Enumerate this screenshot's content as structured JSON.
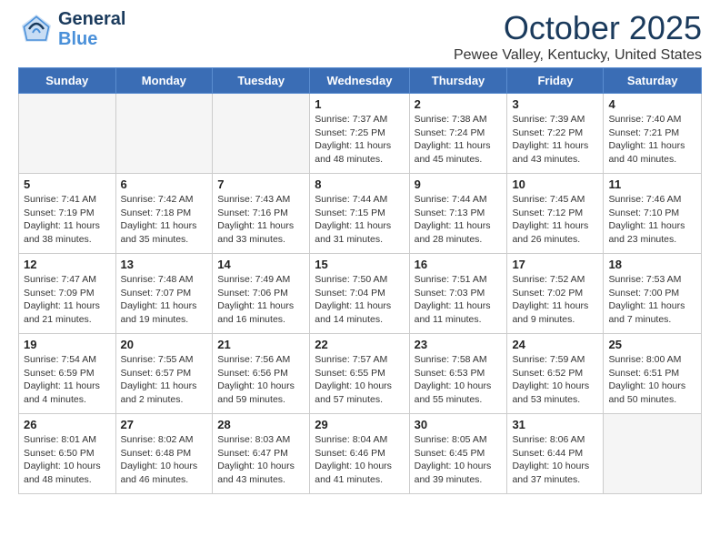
{
  "header": {
    "logo_general": "General",
    "logo_blue": "Blue",
    "month_title": "October 2025",
    "location": "Pewee Valley, Kentucky, United States"
  },
  "days_of_week": [
    "Sunday",
    "Monday",
    "Tuesday",
    "Wednesday",
    "Thursday",
    "Friday",
    "Saturday"
  ],
  "weeks": [
    [
      {
        "day": "",
        "info": ""
      },
      {
        "day": "",
        "info": ""
      },
      {
        "day": "",
        "info": ""
      },
      {
        "day": "1",
        "info": "Sunrise: 7:37 AM\nSunset: 7:25 PM\nDaylight: 11 hours\nand 48 minutes."
      },
      {
        "day": "2",
        "info": "Sunrise: 7:38 AM\nSunset: 7:24 PM\nDaylight: 11 hours\nand 45 minutes."
      },
      {
        "day": "3",
        "info": "Sunrise: 7:39 AM\nSunset: 7:22 PM\nDaylight: 11 hours\nand 43 minutes."
      },
      {
        "day": "4",
        "info": "Sunrise: 7:40 AM\nSunset: 7:21 PM\nDaylight: 11 hours\nand 40 minutes."
      }
    ],
    [
      {
        "day": "5",
        "info": "Sunrise: 7:41 AM\nSunset: 7:19 PM\nDaylight: 11 hours\nand 38 minutes."
      },
      {
        "day": "6",
        "info": "Sunrise: 7:42 AM\nSunset: 7:18 PM\nDaylight: 11 hours\nand 35 minutes."
      },
      {
        "day": "7",
        "info": "Sunrise: 7:43 AM\nSunset: 7:16 PM\nDaylight: 11 hours\nand 33 minutes."
      },
      {
        "day": "8",
        "info": "Sunrise: 7:44 AM\nSunset: 7:15 PM\nDaylight: 11 hours\nand 31 minutes."
      },
      {
        "day": "9",
        "info": "Sunrise: 7:44 AM\nSunset: 7:13 PM\nDaylight: 11 hours\nand 28 minutes."
      },
      {
        "day": "10",
        "info": "Sunrise: 7:45 AM\nSunset: 7:12 PM\nDaylight: 11 hours\nand 26 minutes."
      },
      {
        "day": "11",
        "info": "Sunrise: 7:46 AM\nSunset: 7:10 PM\nDaylight: 11 hours\nand 23 minutes."
      }
    ],
    [
      {
        "day": "12",
        "info": "Sunrise: 7:47 AM\nSunset: 7:09 PM\nDaylight: 11 hours\nand 21 minutes."
      },
      {
        "day": "13",
        "info": "Sunrise: 7:48 AM\nSunset: 7:07 PM\nDaylight: 11 hours\nand 19 minutes."
      },
      {
        "day": "14",
        "info": "Sunrise: 7:49 AM\nSunset: 7:06 PM\nDaylight: 11 hours\nand 16 minutes."
      },
      {
        "day": "15",
        "info": "Sunrise: 7:50 AM\nSunset: 7:04 PM\nDaylight: 11 hours\nand 14 minutes."
      },
      {
        "day": "16",
        "info": "Sunrise: 7:51 AM\nSunset: 7:03 PM\nDaylight: 11 hours\nand 11 minutes."
      },
      {
        "day": "17",
        "info": "Sunrise: 7:52 AM\nSunset: 7:02 PM\nDaylight: 11 hours\nand 9 minutes."
      },
      {
        "day": "18",
        "info": "Sunrise: 7:53 AM\nSunset: 7:00 PM\nDaylight: 11 hours\nand 7 minutes."
      }
    ],
    [
      {
        "day": "19",
        "info": "Sunrise: 7:54 AM\nSunset: 6:59 PM\nDaylight: 11 hours\nand 4 minutes."
      },
      {
        "day": "20",
        "info": "Sunrise: 7:55 AM\nSunset: 6:57 PM\nDaylight: 11 hours\nand 2 minutes."
      },
      {
        "day": "21",
        "info": "Sunrise: 7:56 AM\nSunset: 6:56 PM\nDaylight: 10 hours\nand 59 minutes."
      },
      {
        "day": "22",
        "info": "Sunrise: 7:57 AM\nSunset: 6:55 PM\nDaylight: 10 hours\nand 57 minutes."
      },
      {
        "day": "23",
        "info": "Sunrise: 7:58 AM\nSunset: 6:53 PM\nDaylight: 10 hours\nand 55 minutes."
      },
      {
        "day": "24",
        "info": "Sunrise: 7:59 AM\nSunset: 6:52 PM\nDaylight: 10 hours\nand 53 minutes."
      },
      {
        "day": "25",
        "info": "Sunrise: 8:00 AM\nSunset: 6:51 PM\nDaylight: 10 hours\nand 50 minutes."
      }
    ],
    [
      {
        "day": "26",
        "info": "Sunrise: 8:01 AM\nSunset: 6:50 PM\nDaylight: 10 hours\nand 48 minutes."
      },
      {
        "day": "27",
        "info": "Sunrise: 8:02 AM\nSunset: 6:48 PM\nDaylight: 10 hours\nand 46 minutes."
      },
      {
        "day": "28",
        "info": "Sunrise: 8:03 AM\nSunset: 6:47 PM\nDaylight: 10 hours\nand 43 minutes."
      },
      {
        "day": "29",
        "info": "Sunrise: 8:04 AM\nSunset: 6:46 PM\nDaylight: 10 hours\nand 41 minutes."
      },
      {
        "day": "30",
        "info": "Sunrise: 8:05 AM\nSunset: 6:45 PM\nDaylight: 10 hours\nand 39 minutes."
      },
      {
        "day": "31",
        "info": "Sunrise: 8:06 AM\nSunset: 6:44 PM\nDaylight: 10 hours\nand 37 minutes."
      },
      {
        "day": "",
        "info": ""
      }
    ]
  ]
}
